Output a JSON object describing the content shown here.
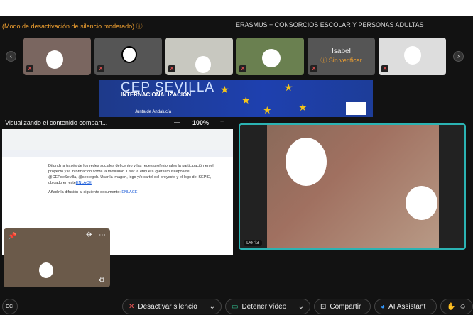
{
  "header": {
    "mode_label": "(Modo de desactivación de silencio moderado)",
    "meeting_title": "ERASMUS + CONSORCIOS ESCOLAR Y PERSONAS ADULTAS"
  },
  "participants": [
    {
      "name": ""
    },
    {
      "name": ""
    },
    {
      "name": ""
    },
    {
      "name": ""
    },
    {
      "name": "Isabel",
      "status": "Sin verificar"
    },
    {
      "name": ""
    }
  ],
  "banner": {
    "title": "CEP SEVILLA",
    "subtitle": "INTERNACIONALIZACIÓN",
    "org": "Junta de Andalucía"
  },
  "share": {
    "title": "Visualizando el contenido compart...",
    "zoom": "100%",
    "minus": "—",
    "plus": "+"
  },
  "document": {
    "para1": "Difundir a través de los redes sociales del centro y las redes profesionales la participación en el proyecto y la información sobre la movilidad. Usar la etiqueta @erasmusceposevi, @CEPdeSevilla, @sepiegob. Usar la imagen, logo y/o cartel del proyecto y el logo del SEPIE, ubicado en este",
    "link1": "ENLACE",
    "para2": "Añadir la difusión al siguiente documento:",
    "link2": "ENLACE"
  },
  "speaker_names": "De 'l3",
  "toolbar": {
    "unmute": "Desactivar silencio",
    "stop_video": "Detener vídeo",
    "share": "Compartir",
    "ai": "AI Assistant"
  },
  "colors": {
    "accent": "#2bb3b3",
    "warning": "#f0a030"
  }
}
